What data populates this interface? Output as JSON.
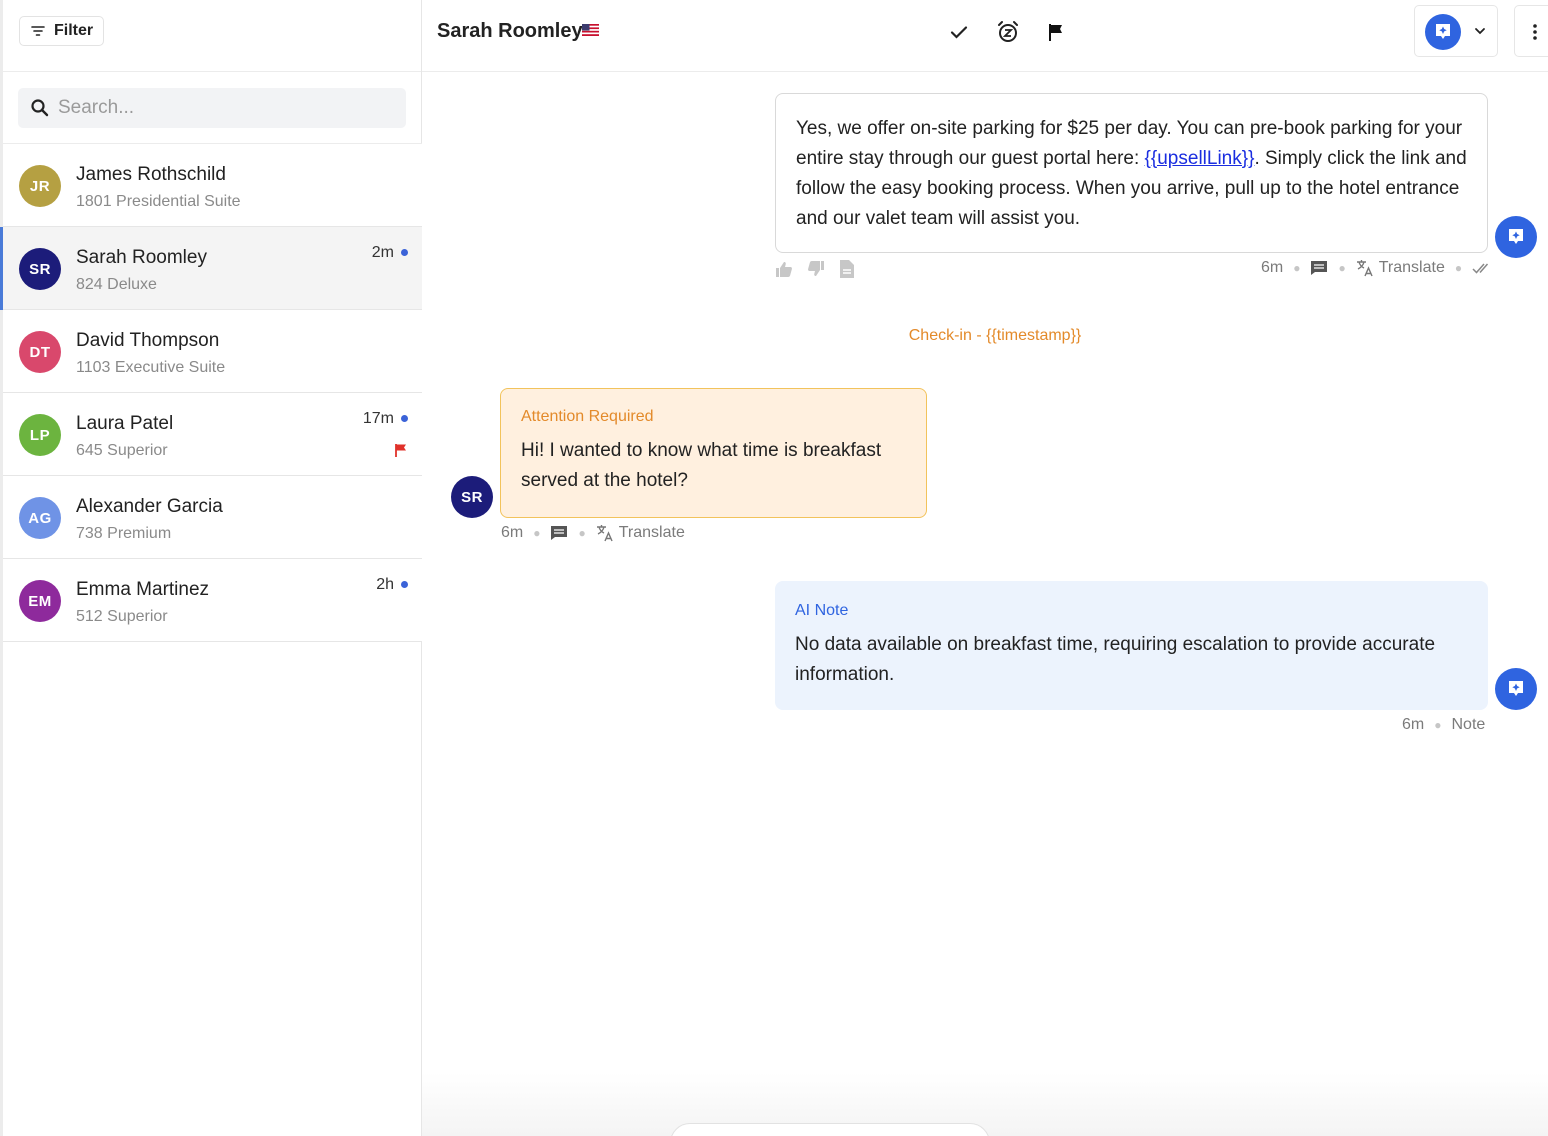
{
  "sidebar": {
    "filter_label": "Filter",
    "search_placeholder": "Search...",
    "conversations": [
      {
        "initials": "JR",
        "name": "James Rothschild",
        "room": "1801 Presidential Suite",
        "time": "",
        "unread": false,
        "flagged": false,
        "color": "#b5a042"
      },
      {
        "initials": "SR",
        "name": "Sarah Roomley",
        "room": "824 Deluxe",
        "time": "2m",
        "unread": true,
        "flagged": false,
        "color": "#1c1c7a",
        "active": true
      },
      {
        "initials": "DT",
        "name": "David Thompson",
        "room": "1103 Executive Suite",
        "time": "",
        "unread": false,
        "flagged": false,
        "color": "#d9486c"
      },
      {
        "initials": "LP",
        "name": "Laura Patel",
        "room": "645 Superior",
        "time": "17m",
        "unread": true,
        "flagged": true,
        "color": "#6cb43f"
      },
      {
        "initials": "AG",
        "name": "Alexander Garcia",
        "room": "738 Premium",
        "time": "",
        "unread": false,
        "flagged": false,
        "color": "#6f93e6"
      },
      {
        "initials": "EM",
        "name": "Emma Martinez",
        "room": "512 Superior",
        "time": "2h",
        "unread": true,
        "flagged": false,
        "color": "#8e2a9c"
      }
    ]
  },
  "header": {
    "guest_name": "Sarah Roomley",
    "icons": [
      "check-icon",
      "snooze-icon",
      "flag-icon",
      "assistant-icon",
      "chevron-down-icon",
      "more-vertical-icon"
    ]
  },
  "chat": {
    "outgoing": {
      "text_before_link": "Yes, we offer on-site parking for $25 per day. You can pre-book parking for your entire stay through our guest portal here: ",
      "link_text": "{{upsellLink}}",
      "text_after_link": ". Simply click the link and follow the easy booking process. When you arrive, pull up to the hotel entrance and our valet team will assist you.",
      "time": "6m",
      "translate_label": "Translate"
    },
    "check_in_label": "Check-in - {{timestamp}}",
    "incoming": {
      "label": "Attention Required",
      "text": "Hi! I wanted to know what time is breakfast served at the hotel?",
      "sender_initials": "SR",
      "time": "6m",
      "translate_label": "Translate"
    },
    "note": {
      "label": "AI Note",
      "text": "No data available on breakfast time, requiring escalation to provide accurate information.",
      "time": "6m",
      "type_label": "Note"
    },
    "colors": {
      "accent": "#2f64e0",
      "attention": "#e38a2a",
      "note_bg": "#ecf3fd"
    }
  }
}
